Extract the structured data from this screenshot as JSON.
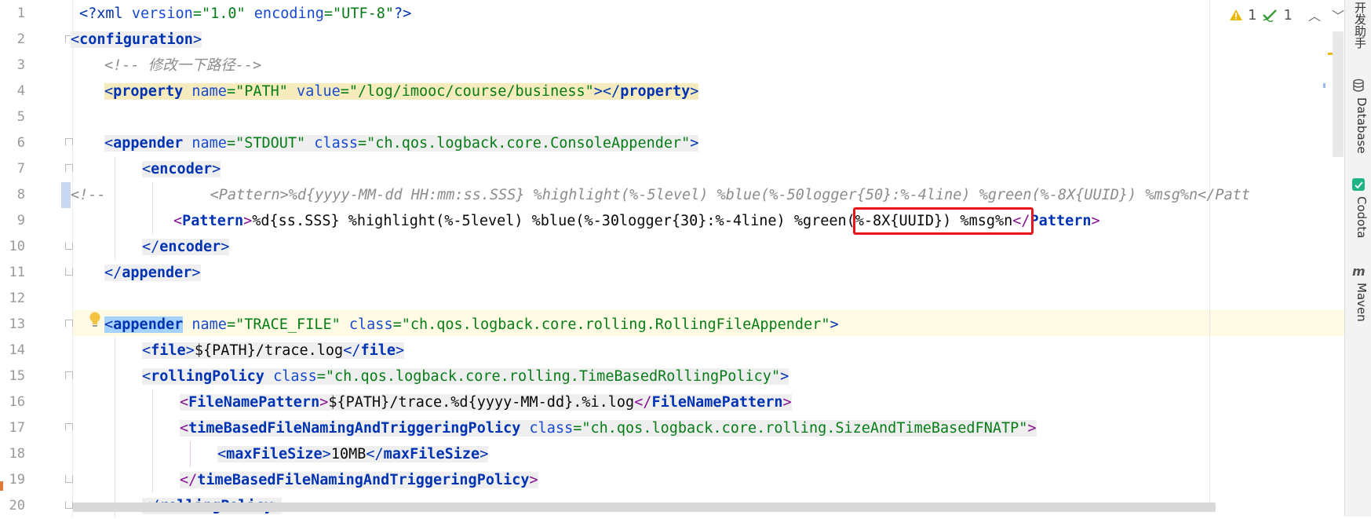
{
  "editor": {
    "line_numbers": [
      "1",
      "2",
      "3",
      "4",
      "5",
      "6",
      "7",
      "8",
      "9",
      "10",
      "11",
      "12",
      "13",
      "14",
      "15",
      "16",
      "17",
      "18",
      "19",
      "20"
    ],
    "lines": {
      "l1_decl_open": "<?",
      "l1_decl_name": "xml",
      "l1_attr1": " version",
      "l1_eq1": "=",
      "l1_val1": "\"1.0\"",
      "l1_attr2": " encoding",
      "l1_eq2": "=",
      "l1_val2": "\"UTF-8\"",
      "l1_decl_close": "?>",
      "l2_open": "<",
      "l2_tag": "configuration",
      "l2_close": ">",
      "l3_comment": "<!-- 修改一下路径-->",
      "l4_open": "<",
      "l4_tag": "property",
      "l4_attr1": " name",
      "l4_eq1": "=",
      "l4_val1": "\"PATH\"",
      "l4_attr2": " value",
      "l4_eq2": "=",
      "l4_val2": "\"/log/imooc/course/business\"",
      "l4_close": "></",
      "l4_ctag": "property",
      "l4_end": ">",
      "l6_open": "<",
      "l6_tag": "appender",
      "l6_attr1": " name",
      "l6_eq1": "=",
      "l6_val1": "\"STDOUT\"",
      "l6_attr2": " class",
      "l6_eq2": "=",
      "l6_val2": "\"ch.qos.logback.core.ConsoleAppender\"",
      "l6_end": ">",
      "l7_open": "<",
      "l7_tag": "encoder",
      "l7_end": ">",
      "l8_comment_start": "<!--",
      "l8_comment_body": "<Pattern>%d{yyyy-MM-dd HH:mm:ss.SSS} %highlight(%-5level) %blue(%-50logger{50}:%-4line) %green(%-8X{UUID}) %msg%n</Patt",
      "l9_open": "<",
      "l9_tag": "Pattern",
      "l9_gt": ">",
      "l9_text_a": "%d{ss.SSS} %highlight(%-5level) %blue(%-30logger{30}:%-4line) ",
      "l9_text_b": "%green(%-8X{UUID})",
      "l9_text_c": " %msg%n",
      "l9_close": "</",
      "l9_ctag": "Pattern",
      "l9_end": ">",
      "l10_open": "</",
      "l10_tag": "encoder",
      "l10_end": ">",
      "l11_open": "</",
      "l11_tag": "appender",
      "l11_end": ">",
      "l13_open": "<",
      "l13_tag": "appender",
      "l13_attr1": " name",
      "l13_eq1": "=",
      "l13_val1": "\"TRACE_FILE\"",
      "l13_attr2": " class",
      "l13_eq2": "=",
      "l13_val2": "\"ch.qos.logback.core.rolling.RollingFileAppender\"",
      "l13_end": ">",
      "l14_open": "<",
      "l14_tag": "file",
      "l14_gt": ">",
      "l14_text": "${PATH}/trace.log",
      "l14_close": "</",
      "l14_ctag": "file",
      "l14_end": ">",
      "l15_open": "<",
      "l15_tag": "rollingPolicy",
      "l15_attr1": " class",
      "l15_eq1": "=",
      "l15_val1": "\"ch.qos.logback.core.rolling.TimeBasedRollingPolicy\"",
      "l15_end": ">",
      "l16_open": "<",
      "l16_tag": "FileNamePattern",
      "l16_gt": ">",
      "l16_text": "${PATH}/trace.%d{yyyy-MM-dd}.%i.log",
      "l16_close": "</",
      "l16_ctag": "FileNamePattern",
      "l16_end": ">",
      "l17_open": "<",
      "l17_tag": "timeBasedFileNamingAndTriggeringPolicy",
      "l17_attr1": " class",
      "l17_eq1": "=",
      "l17_val1": "\"ch.qos.logback.core.rolling.SizeAndTimeBasedFNATP\"",
      "l17_end": ">",
      "l18_open": "<",
      "l18_tag": "maxFileSize",
      "l18_gt": ">",
      "l18_text": "10MB",
      "l18_close": "</",
      "l18_ctag": "maxFileSize",
      "l18_end": ">",
      "l19_open": "</",
      "l19_tag": "timeBasedFileNamingAndTriggeringPolicy",
      "l19_end": ">",
      "l20_open": "</",
      "l20_tag": "rollingPolicy",
      "l20_end": ">"
    }
  },
  "status": {
    "warning_count": "1",
    "check_count": "1"
  },
  "side_panel": {
    "dev_helper": "开发助手",
    "database": "Database",
    "codota": "Codota",
    "maven": "Maven"
  },
  "colors": {
    "tag": "#0033b3",
    "tag_pattern": "#871094",
    "attribute": "#174ad4",
    "string": "#067d17",
    "comment": "#8c8c8c",
    "highlight_box": "#e8161b"
  }
}
